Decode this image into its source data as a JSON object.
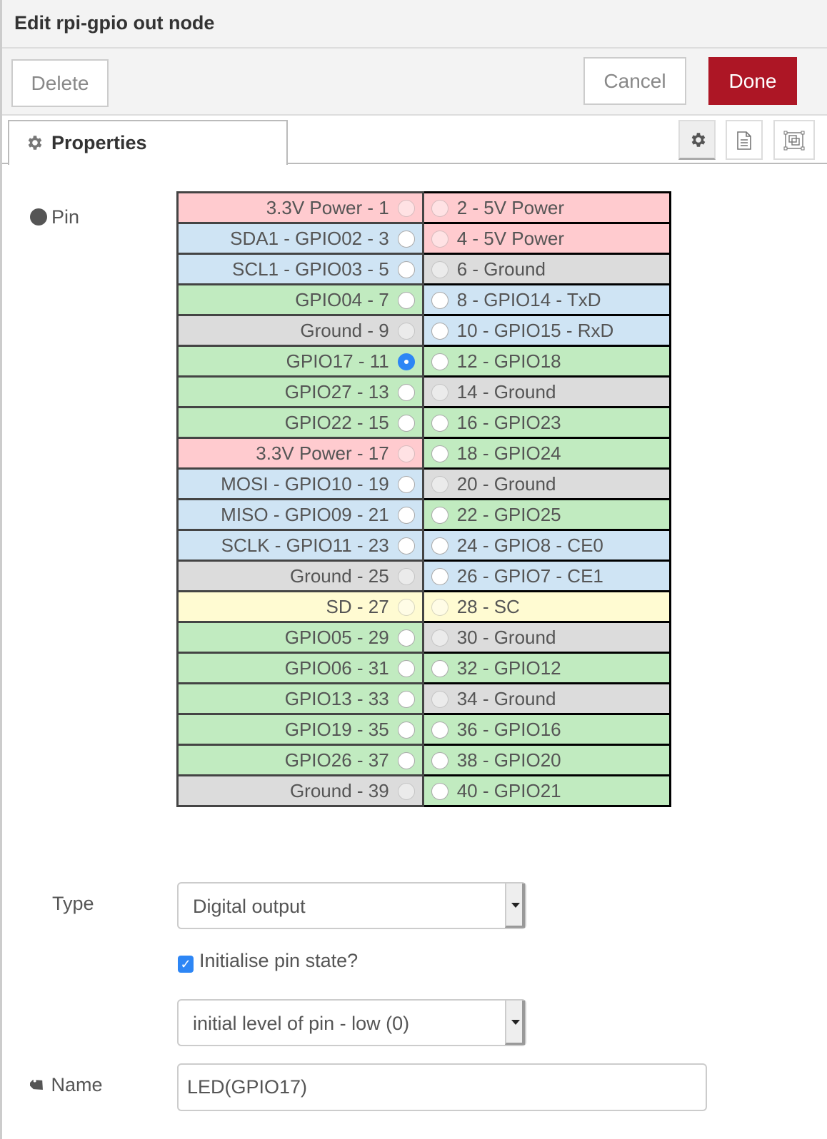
{
  "dialog": {
    "title": "Edit rpi-gpio out node"
  },
  "toolbar": {
    "delete_label": "Delete",
    "cancel_label": "Cancel",
    "done_label": "Done",
    "done_color": "#ad1625"
  },
  "tabs": {
    "properties_label": "Properties",
    "icon_tabs": [
      "gear-icon",
      "document-icon",
      "frame-icon"
    ],
    "active": "gear-icon"
  },
  "pin": {
    "label": "Pin",
    "selected": 11,
    "colors": {
      "power": "#ffcbcf",
      "gpio": "#c1ebc0",
      "special": "#cfe4f4",
      "ground": "#dcdcdc",
      "eeprom": "#fffbd2"
    },
    "rows": [
      {
        "left": {
          "label": "3.3V Power - 1",
          "kind": "power",
          "enabled": false
        },
        "right": {
          "label": "2 - 5V Power",
          "kind": "power",
          "enabled": false
        }
      },
      {
        "left": {
          "label": "SDA1 - GPIO02 - 3",
          "kind": "special",
          "enabled": true
        },
        "right": {
          "label": "4 - 5V Power",
          "kind": "power",
          "enabled": false
        }
      },
      {
        "left": {
          "label": "SCL1 - GPIO03 - 5",
          "kind": "special",
          "enabled": true
        },
        "right": {
          "label": "6 - Ground",
          "kind": "ground",
          "enabled": false
        }
      },
      {
        "left": {
          "label": "GPIO04 - 7",
          "kind": "gpio",
          "enabled": true
        },
        "right": {
          "label": "8 - GPIO14 - TxD",
          "kind": "special",
          "enabled": true
        }
      },
      {
        "left": {
          "label": "Ground - 9",
          "kind": "ground",
          "enabled": false
        },
        "right": {
          "label": "10 - GPIO15 - RxD",
          "kind": "special",
          "enabled": true
        }
      },
      {
        "left": {
          "label": "GPIO17 - 11",
          "kind": "gpio",
          "enabled": true,
          "checked": true
        },
        "right": {
          "label": "12 - GPIO18",
          "kind": "gpio",
          "enabled": true
        }
      },
      {
        "left": {
          "label": "GPIO27 - 13",
          "kind": "gpio",
          "enabled": true
        },
        "right": {
          "label": "14 - Ground",
          "kind": "ground",
          "enabled": false
        }
      },
      {
        "left": {
          "label": "GPIO22 - 15",
          "kind": "gpio",
          "enabled": true
        },
        "right": {
          "label": "16 - GPIO23",
          "kind": "gpio",
          "enabled": true
        }
      },
      {
        "left": {
          "label": "3.3V Power - 17",
          "kind": "power",
          "enabled": false
        },
        "right": {
          "label": "18 - GPIO24",
          "kind": "gpio",
          "enabled": true
        }
      },
      {
        "left": {
          "label": "MOSI - GPIO10 - 19",
          "kind": "special",
          "enabled": true
        },
        "right": {
          "label": "20 - Ground",
          "kind": "ground",
          "enabled": false
        }
      },
      {
        "left": {
          "label": "MISO - GPIO09 - 21",
          "kind": "special",
          "enabled": true
        },
        "right": {
          "label": "22 - GPIO25",
          "kind": "gpio",
          "enabled": true
        }
      },
      {
        "left": {
          "label": "SCLK - GPIO11 - 23",
          "kind": "special",
          "enabled": true
        },
        "right": {
          "label": "24 - GPIO8 - CE0",
          "kind": "special",
          "enabled": true
        }
      },
      {
        "left": {
          "label": "Ground - 25",
          "kind": "ground",
          "enabled": false
        },
        "right": {
          "label": "26 - GPIO7 - CE1",
          "kind": "special",
          "enabled": true
        }
      },
      {
        "left": {
          "label": "SD - 27",
          "kind": "eeprom",
          "enabled": false
        },
        "right": {
          "label": "28 - SC",
          "kind": "eeprom",
          "enabled": false
        }
      },
      {
        "left": {
          "label": "GPIO05 - 29",
          "kind": "gpio",
          "enabled": true
        },
        "right": {
          "label": "30 - Ground",
          "kind": "ground",
          "enabled": false
        }
      },
      {
        "left": {
          "label": "GPIO06 - 31",
          "kind": "gpio",
          "enabled": true
        },
        "right": {
          "label": "32 - GPIO12",
          "kind": "gpio",
          "enabled": true
        }
      },
      {
        "left": {
          "label": "GPIO13 - 33",
          "kind": "gpio",
          "enabled": true
        },
        "right": {
          "label": "34 - Ground",
          "kind": "ground",
          "enabled": false
        }
      },
      {
        "left": {
          "label": "GPIO19 - 35",
          "kind": "gpio",
          "enabled": true
        },
        "right": {
          "label": "36 - GPIO16",
          "kind": "gpio",
          "enabled": true
        }
      },
      {
        "left": {
          "label": "GPIO26 - 37",
          "kind": "gpio",
          "enabled": true
        },
        "right": {
          "label": "38 - GPIO20",
          "kind": "gpio",
          "enabled": true
        }
      },
      {
        "left": {
          "label": "Ground - 39",
          "kind": "ground",
          "enabled": false
        },
        "right": {
          "label": "40 - GPIO21",
          "kind": "gpio",
          "enabled": true
        }
      }
    ]
  },
  "type": {
    "label": "Type",
    "value": "Digital output"
  },
  "init": {
    "label": "Initialise pin state?",
    "checked": true,
    "level_value": "initial level of pin - low (0)"
  },
  "name": {
    "label": "Name",
    "value": "LED(GPIO17)"
  }
}
